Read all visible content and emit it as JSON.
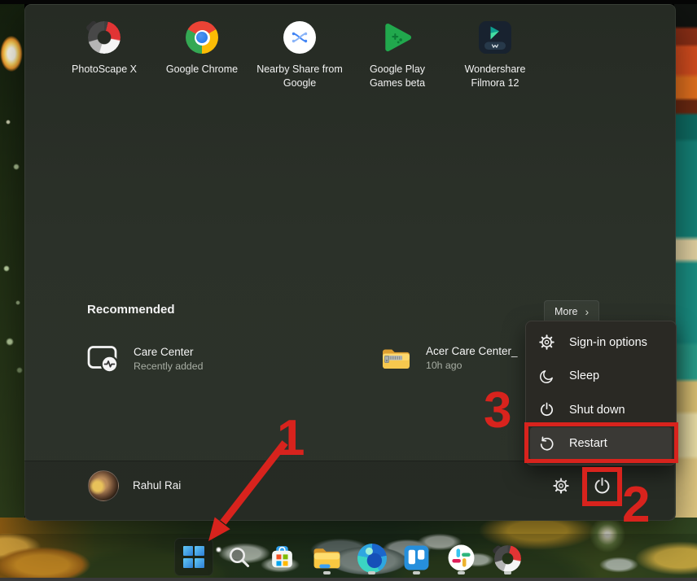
{
  "colors": {
    "annotation_red": "#d8231d",
    "menu_background": "#2b3129",
    "flyout_background": "#2a2924"
  },
  "icons": {
    "chevron_right": "›"
  },
  "start_menu": {
    "pinned_apps": [
      {
        "label": "PhotoScape X",
        "icon": "photoscape-icon"
      },
      {
        "label": "Google Chrome",
        "icon": "chrome-icon"
      },
      {
        "label": "Nearby Share from Google",
        "icon": "nearby-share-icon"
      },
      {
        "label": "Google Play Games beta",
        "icon": "play-games-icon"
      },
      {
        "label": "Wondershare Filmora 12",
        "icon": "filmora-icon"
      }
    ],
    "recommended": {
      "title": "Recommended",
      "more_label": "More",
      "items": [
        {
          "title": "Care Center",
          "subtitle": "Recently added",
          "icon": "care-center-icon"
        },
        {
          "title": "Acer Care Center_",
          "subtitle": "10h ago",
          "icon": "zip-folder-icon"
        }
      ]
    },
    "user": {
      "name": "Rahul Rai"
    },
    "power_menu": {
      "items": [
        {
          "label": "Sign-in options",
          "icon": "gear-icon"
        },
        {
          "label": "Sleep",
          "icon": "moon-icon"
        },
        {
          "label": "Shut down",
          "icon": "power-icon"
        },
        {
          "label": "Restart",
          "icon": "restart-icon",
          "highlighted": true
        }
      ]
    }
  },
  "annotations": {
    "step1": "1",
    "step2": "2",
    "step3": "3"
  },
  "taskbar": {
    "items": [
      {
        "name": "start",
        "running": false
      },
      {
        "name": "search",
        "running": false
      },
      {
        "name": "microsoft-store",
        "running": false
      },
      {
        "name": "file-explorer",
        "running": true
      },
      {
        "name": "microsoft-edge",
        "running": true
      },
      {
        "name": "trello",
        "running": true
      },
      {
        "name": "slack",
        "running": true
      },
      {
        "name": "photoscape-x",
        "running": true
      }
    ]
  }
}
